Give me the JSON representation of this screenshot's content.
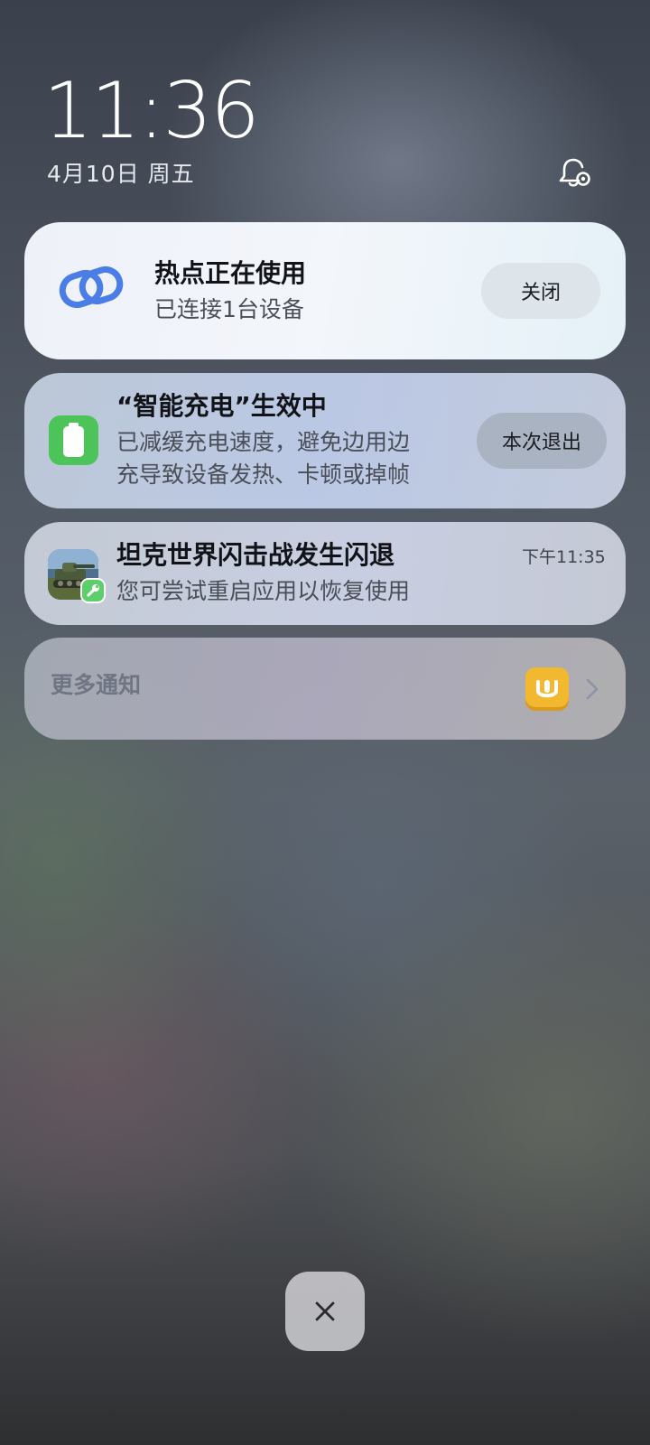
{
  "lockscreen": {
    "time": "11:36",
    "date": "4月10日 周五"
  },
  "notifications": {
    "hotspot": {
      "icon": "link-icon",
      "title": "热点正在使用",
      "subtitle": "已连接1台设备",
      "action_label": "关闭"
    },
    "smart_charging": {
      "icon": "battery-icon",
      "title": "“智能充电”生效中",
      "body_line1": "已减缓充电速度，避免边用边",
      "body_line2": "充导致设备发热、卡顿或掉帧",
      "action_label": "本次退出"
    },
    "app_crash": {
      "icon": "tank-game-icon",
      "badge_icon": "wrench-icon",
      "title": "坦克世界闪击战发生闪退",
      "time": "下午11:35",
      "body": "您可尝试重启应用以恢复使用"
    },
    "more": {
      "label": "更多通知",
      "app_icon": "app-store-icon"
    }
  },
  "actions": {
    "close_icon": "close-icon"
  },
  "colors": {
    "hotspot_icon": "#4a7ee6",
    "battery_icon": "#4cc45a",
    "app_store_icon": "#f2b830"
  }
}
